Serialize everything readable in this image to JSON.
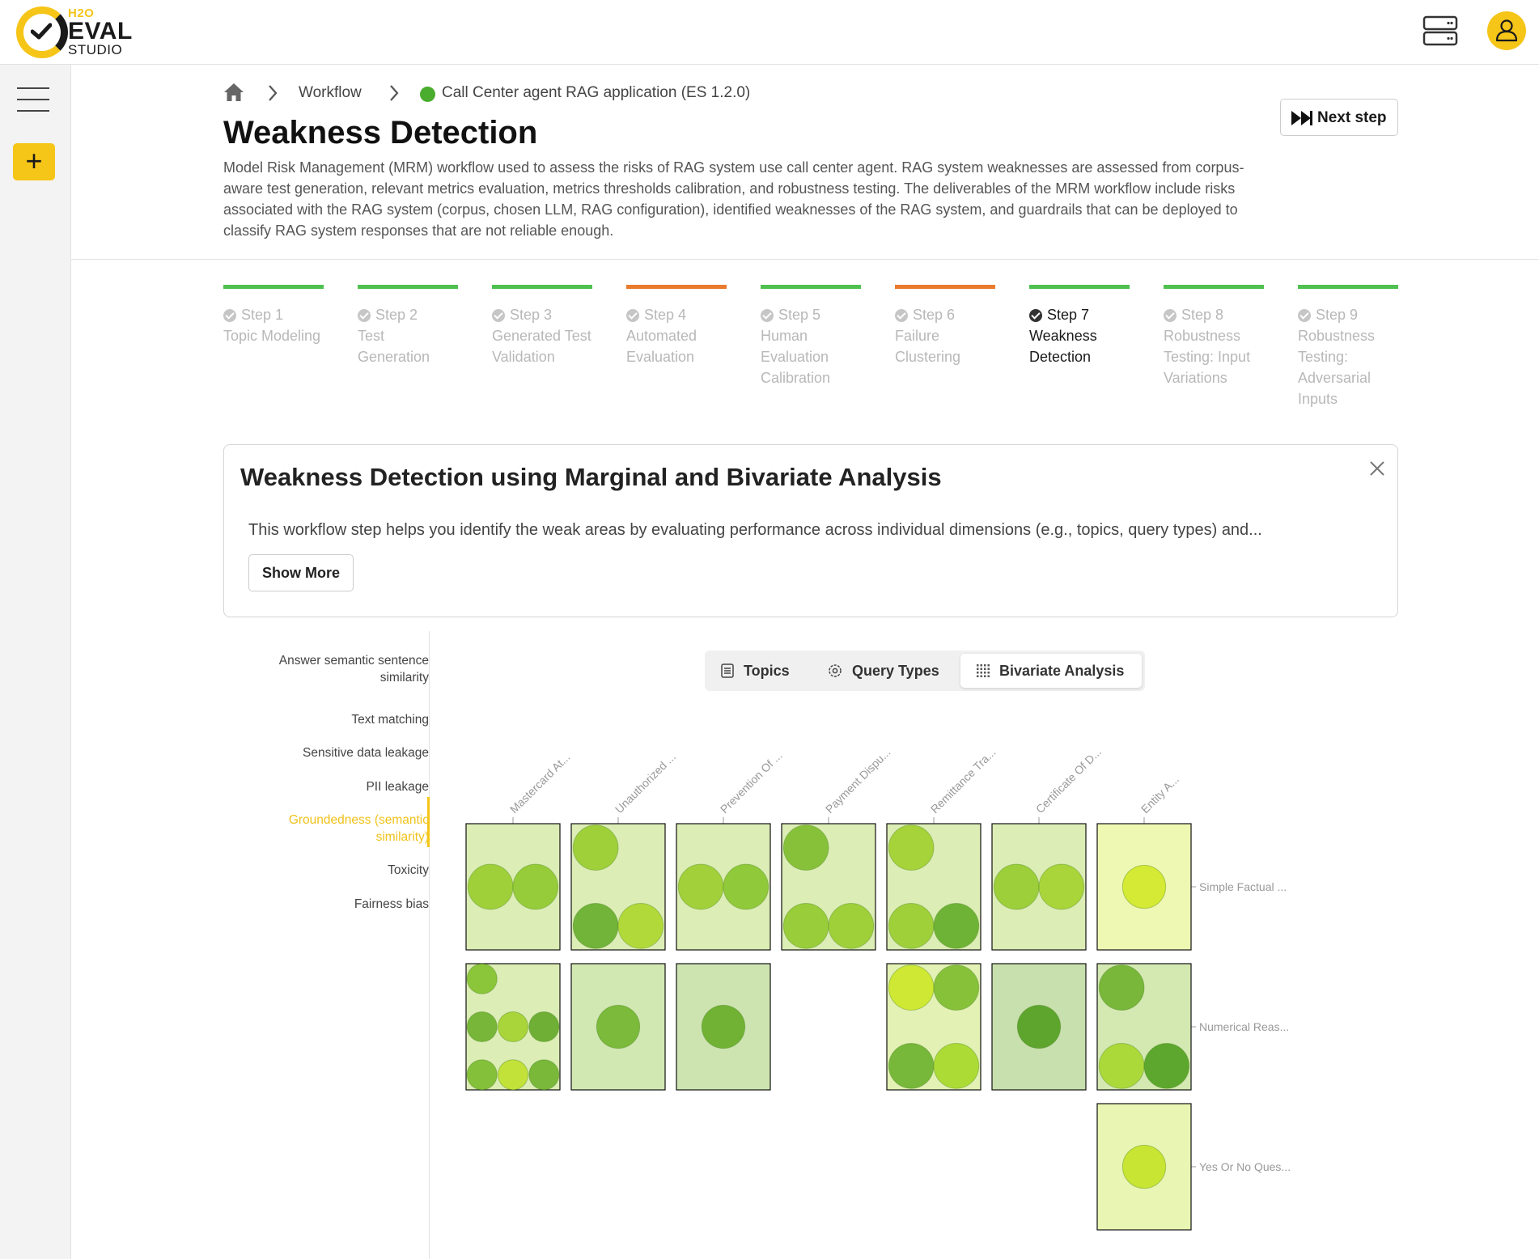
{
  "app": {
    "brand_small": "H2O",
    "brand_main": "EVAL",
    "brand_sub": "STUDIO"
  },
  "breadcrumb": {
    "workflow": "Workflow",
    "app_name": "Call Center agent RAG application (ES 1.2.0)"
  },
  "page": {
    "title": "Weakness Detection",
    "next_step": "Next step",
    "description": "Model Risk Management (MRM) workflow used to assess the risks of RAG system use call center agent. RAG system weaknesses are assessed from corpus-aware test generation, relevant metrics evaluation, metrics thresholds calibration, and robustness testing. The deliverables of the MRM workflow include risks associated with the RAG system (corpus, chosen LLM, RAG configuration), identified weaknesses of the RAG system, and guardrails that can be deployed to classify RAG system responses that are not reliable enough."
  },
  "steps": [
    {
      "num": "Step 1",
      "label": "Topic Modeling",
      "bar": "green"
    },
    {
      "num": "Step 2",
      "label": "Test Generation",
      "bar": "green"
    },
    {
      "num": "Step 3",
      "label": "Generated Test Validation",
      "bar": "green"
    },
    {
      "num": "Step 4",
      "label": "Automated Evaluation",
      "bar": "orange"
    },
    {
      "num": "Step 5",
      "label": "Human Evaluation Calibration",
      "bar": "green"
    },
    {
      "num": "Step 6",
      "label": "Failure Clustering",
      "bar": "orange"
    },
    {
      "num": "Step 7",
      "label": "Weakness Detection",
      "bar": "green",
      "active": true
    },
    {
      "num": "Step 8",
      "label": "Robustness Testing: Input Variations",
      "bar": "green"
    },
    {
      "num": "Step 9",
      "label": "Robustness Testing: Adversarial Inputs",
      "bar": "green"
    }
  ],
  "info": {
    "title": "Weakness Detection using Marginal and Bivariate Analysis",
    "text": "This workflow step helps you identify the weak areas by evaluating performance across individual dimensions (e.g., topics, query types) and...",
    "show_more": "Show More"
  },
  "metrics": [
    {
      "label": "Answer semantic sentence similarity"
    },
    {
      "label": "Text matching"
    },
    {
      "label": "Sensitive data leakage"
    },
    {
      "label": "PII leakage"
    },
    {
      "label": "Groundedness (semantic similarity)",
      "active": true
    },
    {
      "label": "Toxicity"
    },
    {
      "label": "Fairness bias"
    }
  ],
  "tabs": {
    "topics": "Topics",
    "query_types": "Query Types",
    "bivariate": "Bivariate Analysis"
  },
  "colors": {
    "accent": "#f5c518",
    "step_green": "#4ec150",
    "step_orange": "#ea7a2c"
  },
  "chart_data": {
    "type": "heatmap",
    "columns": [
      "Mastercard At...",
      "Unauthorized ...",
      "Prevention Of ...",
      "Payment Dispu...",
      "Remittance Tra...",
      "Certificate Of D...",
      "Entity A..."
    ],
    "rows": [
      "Simple Factual ...",
      "Numerical Reas...",
      "Yes Or No Ques..."
    ],
    "cells": [
      {
        "row": 0,
        "col": 0,
        "bg": "#dcedb5",
        "circles": [
          {
            "c": "#9fd03a"
          },
          {
            "c": "#96cc39"
          }
        ]
      },
      {
        "row": 0,
        "col": 1,
        "bg": "#dcedb5",
        "circles": [
          {
            "c": "#9fd03a"
          },
          {
            "c": "#72b33a"
          },
          {
            "c": "#b2d93a"
          }
        ]
      },
      {
        "row": 0,
        "col": 2,
        "bg": "#dcedb5",
        "circles": [
          {
            "c": "#a2d03a"
          },
          {
            "c": "#90c939"
          }
        ]
      },
      {
        "row": 0,
        "col": 3,
        "bg": "#dcedb5",
        "circles": [
          {
            "c": "#87c13a"
          },
          {
            "c": "#99cd3a"
          },
          {
            "c": "#9fd03a"
          }
        ]
      },
      {
        "row": 0,
        "col": 4,
        "bg": "#dcedb5",
        "circles": [
          {
            "c": "#a6d33a"
          },
          {
            "c": "#9fd03a"
          },
          {
            "c": "#6fb336"
          }
        ]
      },
      {
        "row": 0,
        "col": 5,
        "bg": "#dcedb5",
        "circles": [
          {
            "c": "#9ccf3a"
          },
          {
            "c": "#a9d53a"
          }
        ]
      },
      {
        "row": 0,
        "col": 6,
        "bg": "#eff8b3",
        "circles": [
          {
            "c": "#d4ea34"
          }
        ]
      },
      {
        "row": 1,
        "col": 0,
        "bg": "#dcedb5",
        "circles": [
          {
            "c": "#8bc53a"
          },
          {
            "c": "#77b639"
          },
          {
            "c": "#a9d53a"
          },
          {
            "c": "#6faf36"
          },
          {
            "c": "#85c03a"
          },
          {
            "c": "#c2e23a"
          },
          {
            "c": "#7ab83a"
          }
        ]
      },
      {
        "row": 1,
        "col": 1,
        "bg": "#d2e8b3",
        "circles": [
          {
            "c": "#7bba3a"
          }
        ]
      },
      {
        "row": 1,
        "col": 2,
        "bg": "#cde4b1",
        "circles": [
          {
            "c": "#71b234"
          }
        ]
      },
      {
        "row": 1,
        "col": 4,
        "bg": "#e3f1b5",
        "circles": [
          {
            "c": "#cfe834"
          },
          {
            "c": "#87c13a"
          },
          {
            "c": "#77b739"
          },
          {
            "c": "#addb36"
          }
        ]
      },
      {
        "row": 1,
        "col": 5,
        "bg": "#c8e0ad",
        "circles": [
          {
            "c": "#5ea52e"
          }
        ]
      },
      {
        "row": 1,
        "col": 6,
        "bg": "#d4e9b2",
        "circles": [
          {
            "c": "#79b73a"
          },
          {
            "c": "#acd93a"
          },
          {
            "c": "#5ea72e"
          }
        ]
      },
      {
        "row": 2,
        "col": 6,
        "bg": "#e9f5b2",
        "circles": [
          {
            "c": "#c8e534"
          }
        ]
      }
    ]
  }
}
